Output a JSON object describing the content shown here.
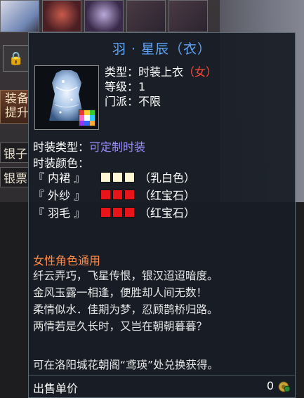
{
  "background": {
    "lock_glyph": "🔒",
    "equip_button": "装备\n提升",
    "silver_label": "银子",
    "note_label": "银票"
  },
  "tooltip": {
    "title": "羽 · 星辰（衣）",
    "attributes": {
      "type_label": "类型：",
      "type_value": "时装上衣",
      "type_gender": "（女）",
      "level_label": "等级：",
      "level_value": "1",
      "sect_label": "门派：",
      "sect_value": "不限"
    },
    "fashion_type_label": "时装类型：",
    "fashion_type_value": "可定制时装",
    "fashion_color_label": "时装颜色：",
    "color_parts": [
      {
        "part": "『 内裙 』",
        "swatch_color": "#fdf7d6",
        "color_name": "（乳白色）"
      },
      {
        "part": "『 外纱 』",
        "swatch_color": "#e8141a",
        "color_name": "（红宝石）"
      },
      {
        "part": "『 羽毛 』",
        "swatch_color": "#e8141a",
        "color_name": "（红宝石）"
      }
    ],
    "description_heading": "女性角色通用",
    "poem_lines": [
      "纤云弄巧，飞星传恨，银汉迢迢暗度。",
      "金风玉露一相逢，便胜却人间无数！",
      "柔情似水．佳期为梦，忍顾鹊桥归路。",
      "两情若是久长时，又岂在朝朝暮暮？"
    ],
    "source_text": "可在洛阳城花朝阁“鸢瑛”处兑换获得。",
    "sell_label": "出售单价",
    "sell_value": "0",
    "icons": {
      "item": "garment-icon",
      "palette": "palette-icon",
      "coin": "coin-icon"
    },
    "colors": {
      "title": "#5ea3f5",
      "gender": "#ff4a3a",
      "customizable": "#9b8cff",
      "heading": "#ff8a4a"
    }
  }
}
